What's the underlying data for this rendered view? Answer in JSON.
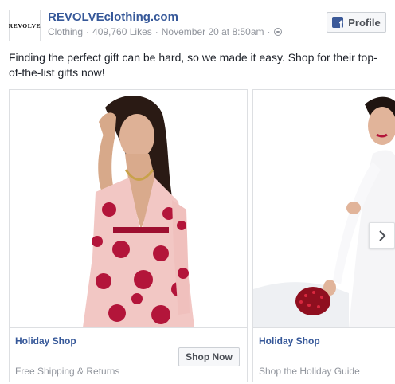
{
  "page": {
    "logo_text": "REVOLVE",
    "name": "REVOLVEclothing.com",
    "category": "Clothing",
    "likes": "409,760 Likes",
    "timestamp": "November 20 at 8:50am",
    "separator": "·"
  },
  "profile_button": {
    "label": "Profile",
    "icon": "facebook-icon"
  },
  "message": "Finding the perfect gift can be hard, so we made it easy. Shop for their top-of-the-list gifts now!",
  "carousel": {
    "cards": [
      {
        "title": "Holiday Shop",
        "description": "Free Shipping & Returns",
        "cta_label": "Shop Now",
        "image": "model-red-floral-dress"
      },
      {
        "title": "Holiday Shop",
        "description": "Shop the Holiday Guide",
        "image": "model-white-dress-sequin-clutch"
      }
    ],
    "next_icon": "chevron-right-icon"
  },
  "colors": {
    "link_blue": "#365899",
    "meta_gray": "#90949c",
    "facebook_blue": "#3b5998",
    "dress_red": "#b3153a"
  }
}
